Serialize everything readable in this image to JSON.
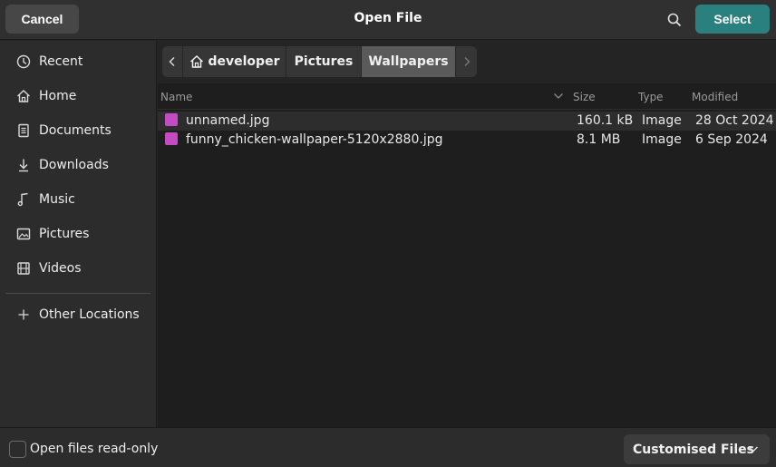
{
  "header": {
    "title": "Open File",
    "cancel_label": "Cancel",
    "select_label": "Select",
    "search_icon": "search-icon"
  },
  "sidebar": {
    "items": [
      {
        "label": "Recent",
        "icon": "clock-icon"
      },
      {
        "label": "Home",
        "icon": "home-icon"
      },
      {
        "label": "Documents",
        "icon": "document-icon"
      },
      {
        "label": "Downloads",
        "icon": "download-icon"
      },
      {
        "label": "Music",
        "icon": "music-icon"
      },
      {
        "label": "Pictures",
        "icon": "picture-icon"
      },
      {
        "label": "Videos",
        "icon": "film-icon"
      }
    ],
    "other_locations": {
      "label": "Other Locations",
      "icon": "plus-icon"
    }
  },
  "pathbar": {
    "segments": [
      "developer",
      "Pictures",
      "Wallpapers"
    ],
    "current": "Wallpapers"
  },
  "columns": {
    "name": "Name",
    "size": "Size",
    "type": "Type",
    "modified": "Modified"
  },
  "files": [
    {
      "name": "unnamed.jpg",
      "size": "160.1 kB",
      "type": "Image",
      "modified": "28 Oct 2024",
      "selected": true
    },
    {
      "name": "funny_chicken-wallpaper-5120x2880.jpg",
      "size": "8.1 MB",
      "type": "Image",
      "modified": "6 Sep 2024",
      "selected": false
    }
  ],
  "footer": {
    "readonly_label": "Open files read-only",
    "readonly_checked": false,
    "filter_label": "Customised Files"
  },
  "colors": {
    "accent": "#2a7f7f",
    "image_icon": "#c44bc4"
  }
}
